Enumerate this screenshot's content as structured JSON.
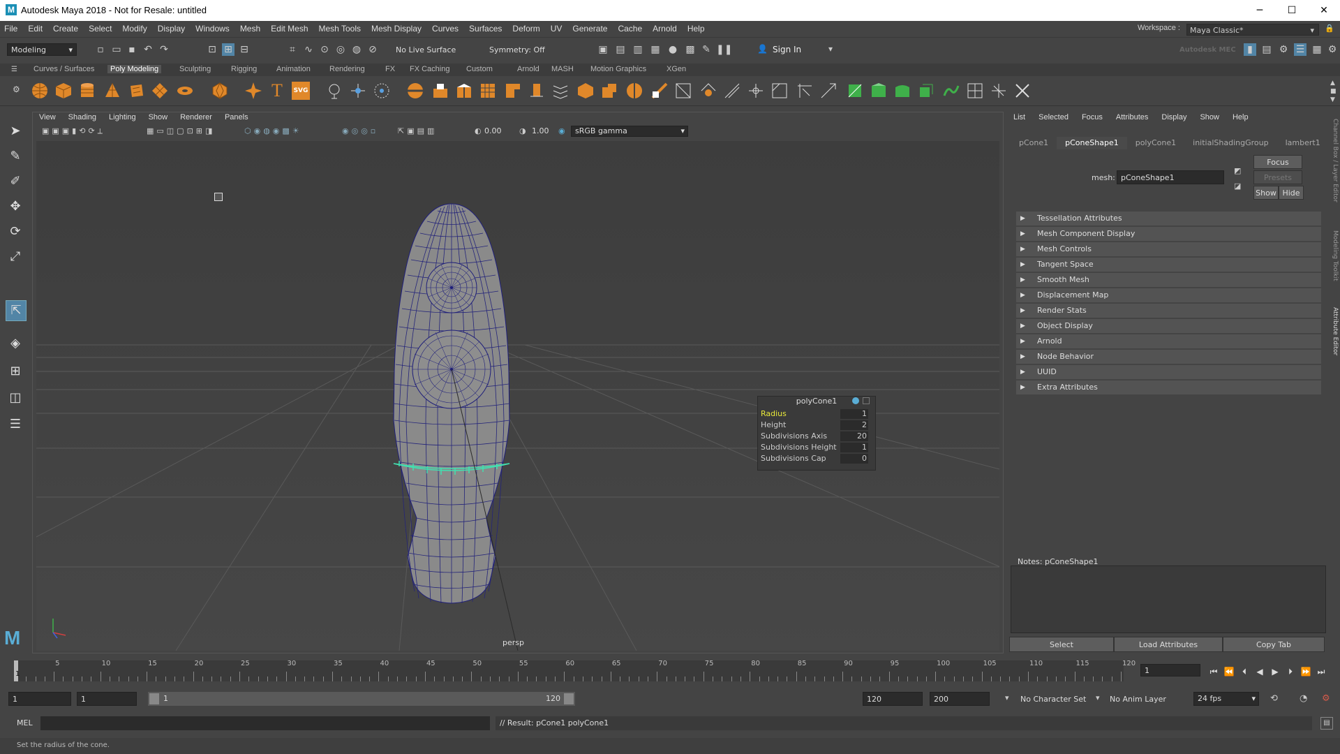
{
  "window": {
    "title": "Autodesk Maya 2018 - Not for Resale: untitled",
    "logo": "M",
    "controls": [
      "─",
      "☐",
      "✕"
    ]
  },
  "menubar": {
    "items": [
      "File",
      "Edit",
      "Create",
      "Select",
      "Modify",
      "Display",
      "Windows",
      "Mesh",
      "Edit Mesh",
      "Mesh Tools",
      "Mesh Display",
      "Curves",
      "Surfaces",
      "Deform",
      "UV",
      "Generate",
      "Cache",
      "Arnold",
      "Help"
    ],
    "workspace_label": "Workspace :",
    "workspace_value": "Maya Classic*"
  },
  "statusline": {
    "mode": "Modeling",
    "live_surface": "No Live Surface",
    "symmetry": "Symmetry: Off",
    "sign_in": "Sign In",
    "brand": "Autodesk MEC"
  },
  "shelf": {
    "tabs": [
      "Curves / Surfaces",
      "Poly Modeling",
      "Sculpting",
      "Rigging",
      "Animation",
      "Rendering",
      "FX",
      "FX Caching",
      "Custom",
      "Arnold",
      "MASH",
      "Motion Graphics",
      "XGen"
    ],
    "active_tab": "Poly Modeling",
    "text_icon": "T",
    "svg_icon": "SVG"
  },
  "viewport": {
    "menu": [
      "View",
      "Shading",
      "Lighting",
      "Show",
      "Renderer",
      "Panels"
    ],
    "exposure": "0.00",
    "gamma": "1.00",
    "colorspace": "sRGB gamma",
    "camera": "persp"
  },
  "inputbox": {
    "node": "polyCone1",
    "attributes": [
      {
        "name": "Radius",
        "value": "1",
        "highlighted": true
      },
      {
        "name": "Height",
        "value": "2",
        "highlighted": false
      },
      {
        "name": "Subdivisions Axis",
        "value": "20",
        "highlighted": false
      },
      {
        "name": "Subdivisions Height",
        "value": "1",
        "highlighted": false
      },
      {
        "name": "Subdivisions Cap",
        "value": "0",
        "highlighted": false
      }
    ]
  },
  "attribute_editor": {
    "menu": [
      "List",
      "Selected",
      "Focus",
      "Attributes",
      "Display",
      "Show",
      "Help"
    ],
    "tabs": [
      "pCone1",
      "pConeShape1",
      "polyCone1",
      "initialShadingGroup",
      "lambert1"
    ],
    "active_tab": "pConeShape1",
    "mesh_label": "mesh:",
    "mesh_value": "pConeShape1",
    "focus_btn": "Focus",
    "presets_btn": "Presets",
    "show_btn": "Show",
    "hide_btn": "Hide",
    "sections": [
      "Tessellation Attributes",
      "Mesh Component Display",
      "Mesh Controls",
      "Tangent Space",
      "Smooth Mesh",
      "Displacement Map",
      "Render Stats",
      "Object Display",
      "Arnold",
      "Node Behavior",
      "UUID",
      "Extra Attributes"
    ],
    "notes_label": "Notes:  pConeShape1",
    "buttons": [
      "Select",
      "Load Attributes",
      "Copy Tab"
    ],
    "side_tabs": [
      "Channel Box / Layer Editor",
      "Modeling Toolkit",
      "Attribute Editor"
    ]
  },
  "timeline": {
    "ticks": [
      "5",
      "10",
      "15",
      "20",
      "25",
      "30",
      "35",
      "40",
      "45",
      "50",
      "55",
      "60",
      "65",
      "70",
      "75",
      "80",
      "85",
      "90",
      "95",
      "100",
      "105",
      "110",
      "115",
      "120"
    ],
    "current_frame": "1",
    "frame_field": "1"
  },
  "range": {
    "start": "1",
    "anim_start": "1",
    "slider_start": "1",
    "slider_end": "120",
    "anim_end": "120",
    "end": "200",
    "character_set": "No Character Set",
    "anim_layer": "No Anim Layer",
    "fps": "24 fps"
  },
  "command": {
    "language": "MEL",
    "result": "// Result: pCone1 polyCone1"
  },
  "helpline": "Set the radius of the cone.",
  "colors": {
    "accent": "#5285a6",
    "highlight_yellow": "#e8e83a",
    "selected_edge": "#41e0b0",
    "wire": "#1e1e7a"
  }
}
